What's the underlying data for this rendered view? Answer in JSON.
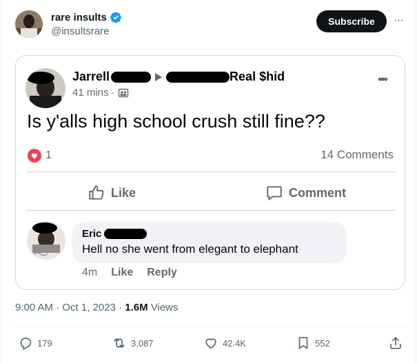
{
  "author": {
    "name": "rare insults",
    "handle": "@insultsrare",
    "verified": true
  },
  "subscribe_label": "Subscribe",
  "more_label": "···",
  "post": {
    "poster_name": "Jarrell",
    "group_suffix": "Real $hid",
    "time": "41 mins",
    "meta_sep": "·",
    "text": "Is y'alls high school crush still fine??",
    "reaction_count": "1",
    "comments_count": "14 Comments",
    "like_label": "Like",
    "comment_label": "Comment",
    "more_label": "•••"
  },
  "comment": {
    "name": "Eric",
    "text": "Hell no she went from elegant to elephant",
    "time": "4m",
    "like_label": "Like",
    "reply_label": "Reply"
  },
  "footer": {
    "time": "9:00 AM",
    "date": "Oct 1, 2023",
    "views": "1.6M",
    "views_label": "Views",
    "dot": "·"
  },
  "stats": {
    "replies": "179",
    "reposts": "3,087",
    "likes": "42.4K",
    "bookmarks": "552"
  },
  "colors": {
    "verified": "#1d9bf0",
    "fb_heart": "#f33e58",
    "text": "#0f1419",
    "muted": "#536471"
  }
}
